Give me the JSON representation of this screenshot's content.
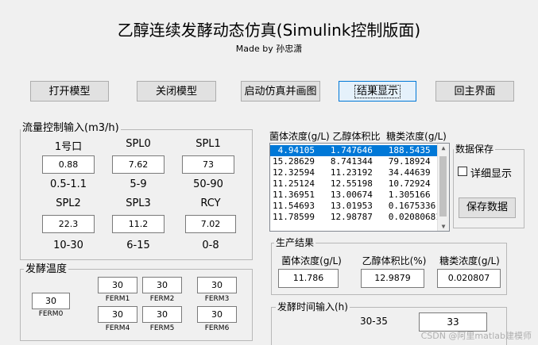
{
  "header": {
    "title": "乙醇连续发酵动态仿真(Simulink控制版面)",
    "subtitle": "Made by 孙忠潇"
  },
  "toolbar": {
    "open_model": "打开模型",
    "close_model": "关闭模型",
    "run_plot": "启动仿真并画图",
    "show_result": "结果显示",
    "main_menu": "回主界面"
  },
  "flow": {
    "title": "流量控制输入(m3/h)",
    "items": [
      {
        "label": "1号口",
        "value": "0.88",
        "range": "0.5-1.1"
      },
      {
        "label": "SPL0",
        "value": "7.62",
        "range": "5-9"
      },
      {
        "label": "SPL1",
        "value": "73",
        "range": "50-90"
      },
      {
        "label": "SPL2",
        "value": "22.3",
        "range": "10-30"
      },
      {
        "label": "SPL3",
        "value": "11.2",
        "range": "6-15"
      },
      {
        "label": "RCY",
        "value": "7.02",
        "range": "0-8"
      }
    ]
  },
  "ferm_temp": {
    "title": "发酵温度",
    "items": [
      {
        "label": "FERM0",
        "value": "30"
      },
      {
        "label": "FERM1",
        "value": "30"
      },
      {
        "label": "FERM2",
        "value": "30"
      },
      {
        "label": "FERM3",
        "value": "30"
      },
      {
        "label": "FERM4",
        "value": "30"
      },
      {
        "label": "FERM5",
        "value": "30"
      },
      {
        "label": "FERM6",
        "value": "30"
      }
    ]
  },
  "results_list": {
    "header": "菌体浓度(g/L) 乙醇体积比  糖类浓度(g/L)",
    "rows": [
      " 4.94105   1.747646   188.5435",
      "15.28629   8.741344   79.18924",
      "12.32594   11.23192   34.44639",
      "11.25124   12.55198   10.72924",
      "11.36951   13.00674   1.305166",
      "11.54693   13.01953   0.1675336",
      "11.78599   12.98787   0.02080681"
    ],
    "selected_index": 0
  },
  "data_save": {
    "title": "数据保存",
    "detail_label": "详细显示",
    "detail_checked": false,
    "save_button": "保存数据"
  },
  "production": {
    "title": "生产结果",
    "items": [
      {
        "label": "菌体浓度(g/L)",
        "value": "11.786"
      },
      {
        "label": "乙醇体积比(%)",
        "value": "12.9879"
      },
      {
        "label": "糖类浓度(g/L)",
        "value": "0.020807"
      }
    ]
  },
  "ferm_time": {
    "title": "发酵时间输入(h)",
    "range": "30-35",
    "value": "33"
  },
  "watermark": "CSDN @阿里matlab建模师"
}
